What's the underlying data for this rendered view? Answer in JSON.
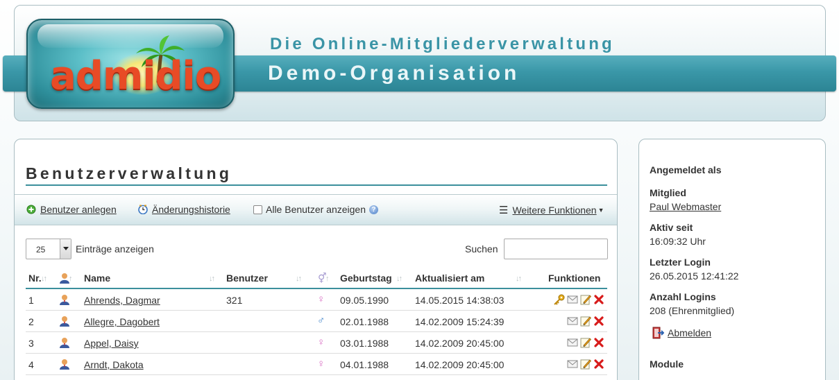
{
  "header": {
    "logo_text": "admidio",
    "tagline": "Die Online-Mitgliederverwaltung",
    "org_name": "Demo-Organisation"
  },
  "main": {
    "title": "Benutzerverwaltung",
    "toolbar": {
      "add_user": "Benutzer anlegen",
      "history": "Änderungshistorie",
      "show_all": "Alle Benutzer anzeigen",
      "show_all_checked": false,
      "more": "Weitere Funktionen"
    },
    "length": {
      "value": "25",
      "label": "Einträge anzeigen"
    },
    "search": {
      "label": "Suchen",
      "value": ""
    },
    "table": {
      "columns": [
        "Nr.",
        "",
        "Name",
        "Benutzer",
        "",
        "Geburtstag",
        "Aktualisiert am",
        "Funktionen"
      ],
      "rows": [
        {
          "nr": "1",
          "name": "Ahrends, Dagmar",
          "user": "321",
          "gender": "female",
          "birthday": "09.05.1990",
          "updated": "14.05.2015 14:38:03",
          "has_key": true
        },
        {
          "nr": "2",
          "name": "Allegre, Dagobert",
          "user": "",
          "gender": "male",
          "birthday": "02.01.1988",
          "updated": "14.02.2009 15:24:39",
          "has_key": false
        },
        {
          "nr": "3",
          "name": "Appel, Daisy",
          "user": "",
          "gender": "female",
          "birthday": "03.01.1988",
          "updated": "14.02.2009 20:45:00",
          "has_key": false
        },
        {
          "nr": "4",
          "name": "Arndt, Dakota",
          "user": "",
          "gender": "female",
          "birthday": "04.01.1988",
          "updated": "14.02.2009 20:45:00",
          "has_key": false
        }
      ]
    }
  },
  "sidebar": {
    "logged_in_as": "Angemeldet als",
    "member_label": "Mitglied",
    "member_name": "Paul Webmaster",
    "active_since_label": "Aktiv seit",
    "active_since": "16:09:32 Uhr",
    "last_login_label": "Letzter Login",
    "last_login": "26.05.2015 12:41:22",
    "login_count_label": "Anzahl Logins",
    "login_count": "208 (Ehrenmitglied)",
    "logout": "Abmelden",
    "modules": "Module"
  },
  "colors": {
    "accent": "#3b8f9c",
    "band": "#3a97a8",
    "delete": "#d81b1b"
  }
}
